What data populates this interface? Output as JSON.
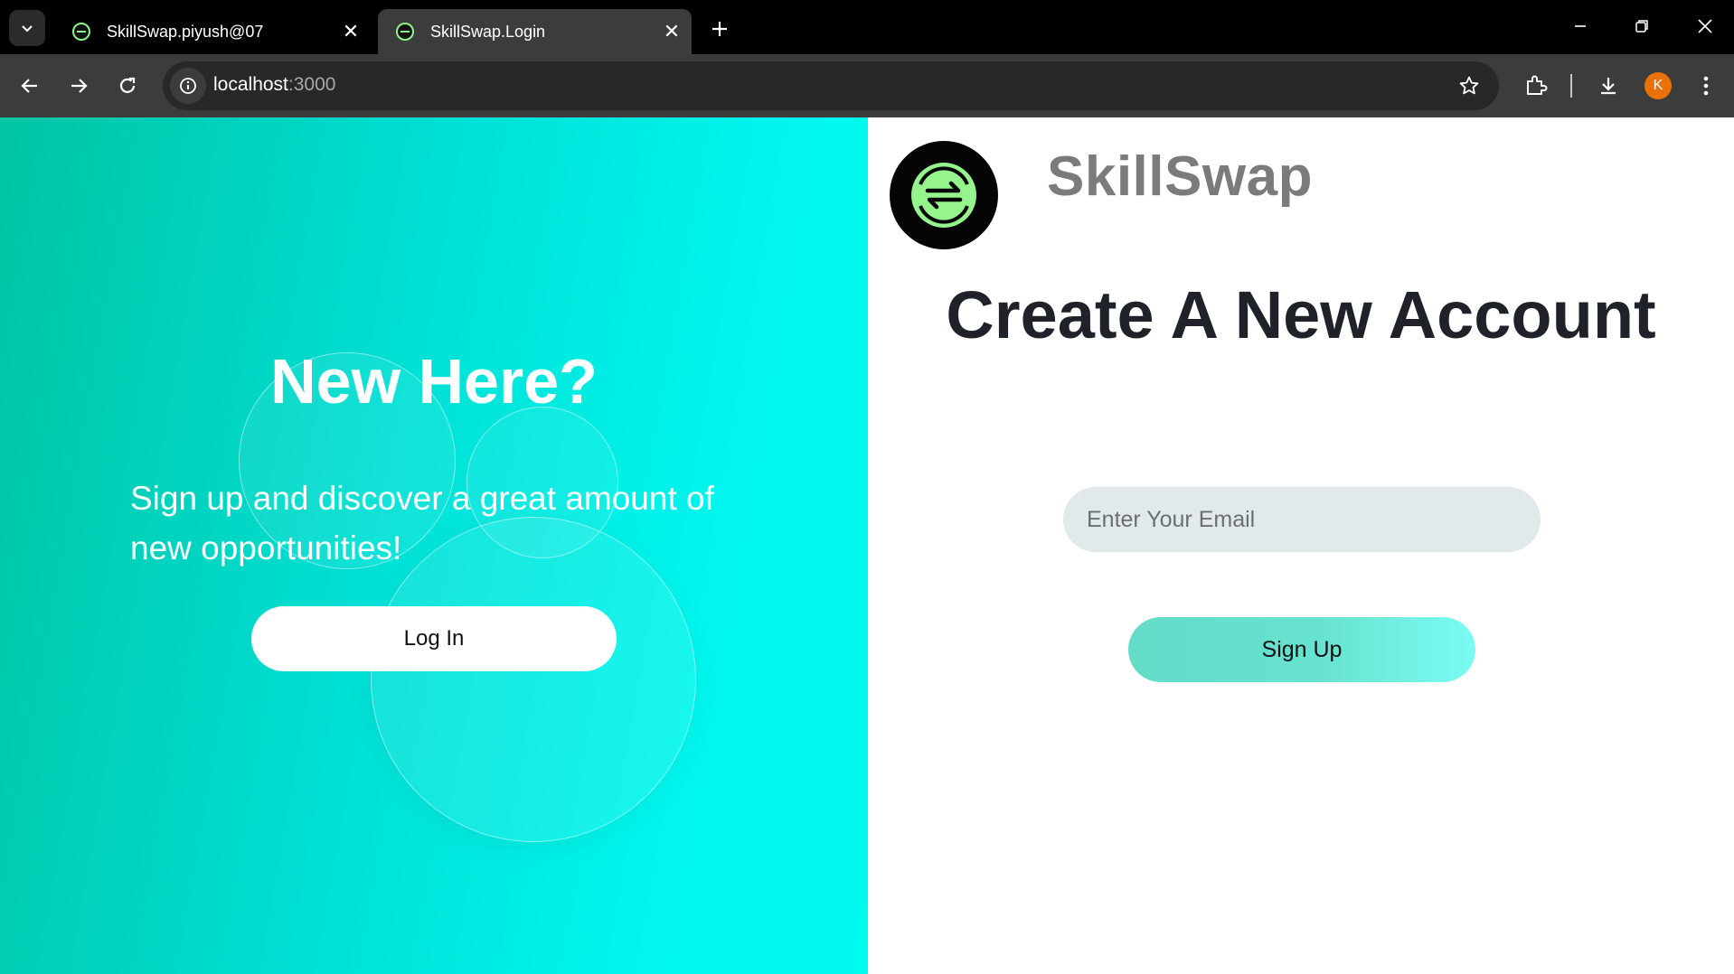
{
  "browser": {
    "tabs": [
      {
        "title": "SkillSwap.piyush@07",
        "active": false
      },
      {
        "title": "SkillSwap.Login",
        "active": true
      }
    ],
    "url_host": "localhost",
    "url_port": ":3000",
    "profile_initial": "K",
    "profile_color": "#e8710a",
    "icons": [
      "tab-search-icon",
      "close-icon",
      "plus-icon",
      "minimize-icon",
      "restore-icon",
      "back-icon",
      "forward-icon",
      "reload-icon",
      "site-info-icon",
      "star-icon",
      "extensions-icon",
      "download-icon",
      "more-icon"
    ]
  },
  "left_panel": {
    "heading": "New Here?",
    "text": "Sign up and discover a great amount of new opportunities!",
    "login_label": "Log In",
    "gradient": [
      "#00c4a3",
      "#00fbef"
    ]
  },
  "right_panel": {
    "brand": "SkillSwap",
    "logo_icon": "swap-arrows-icon",
    "heading": "Create A New Account",
    "email_placeholder": "Enter Your Email",
    "email_value": "",
    "signup_label": "Sign Up"
  }
}
